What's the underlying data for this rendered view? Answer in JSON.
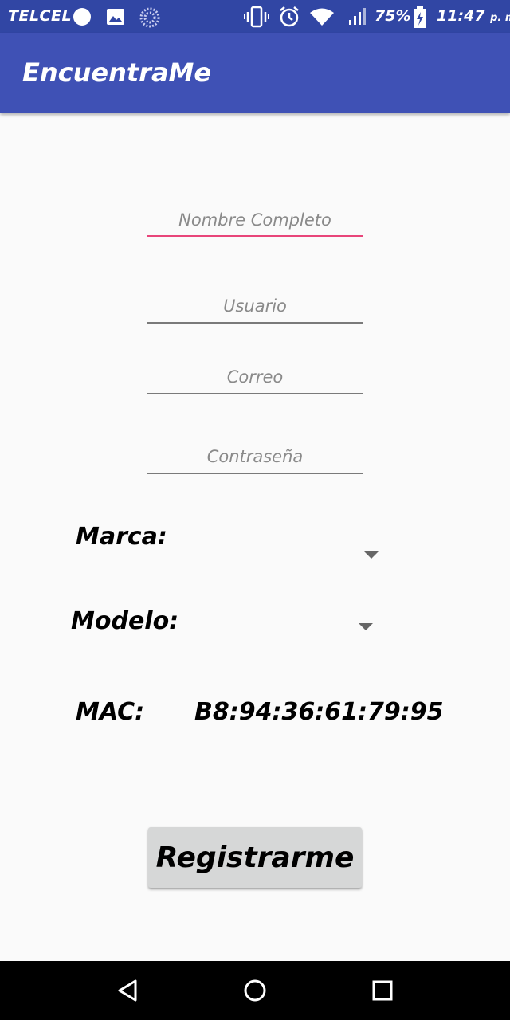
{
  "status_bar": {
    "carrier": "TELCEL",
    "battery_percent": "75%",
    "time": "11:47",
    "time_suffix": "p. m.",
    "icons": [
      "dot-icon",
      "image-icon",
      "loader-icon",
      "vibrate-icon",
      "alarm-icon",
      "wifi-icon",
      "signal-icon",
      "battery-charging-icon"
    ]
  },
  "app_bar": {
    "title": "EncuentraMe",
    "color": "#3f51b5"
  },
  "form": {
    "full_name_placeholder": "Nombre Completo",
    "username_placeholder": "Usuario",
    "email_placeholder": "Correo",
    "password_placeholder": "Contraseña",
    "brand_label": "Marca:",
    "model_label": "Modelo:",
    "mac_label": "MAC:",
    "mac_value": "B8:94:36:61:79:95",
    "register_label": "Registrarme",
    "accent_color": "#e8457a"
  },
  "nav_bar": {
    "icons": [
      "back-icon",
      "home-icon",
      "recents-icon"
    ]
  }
}
